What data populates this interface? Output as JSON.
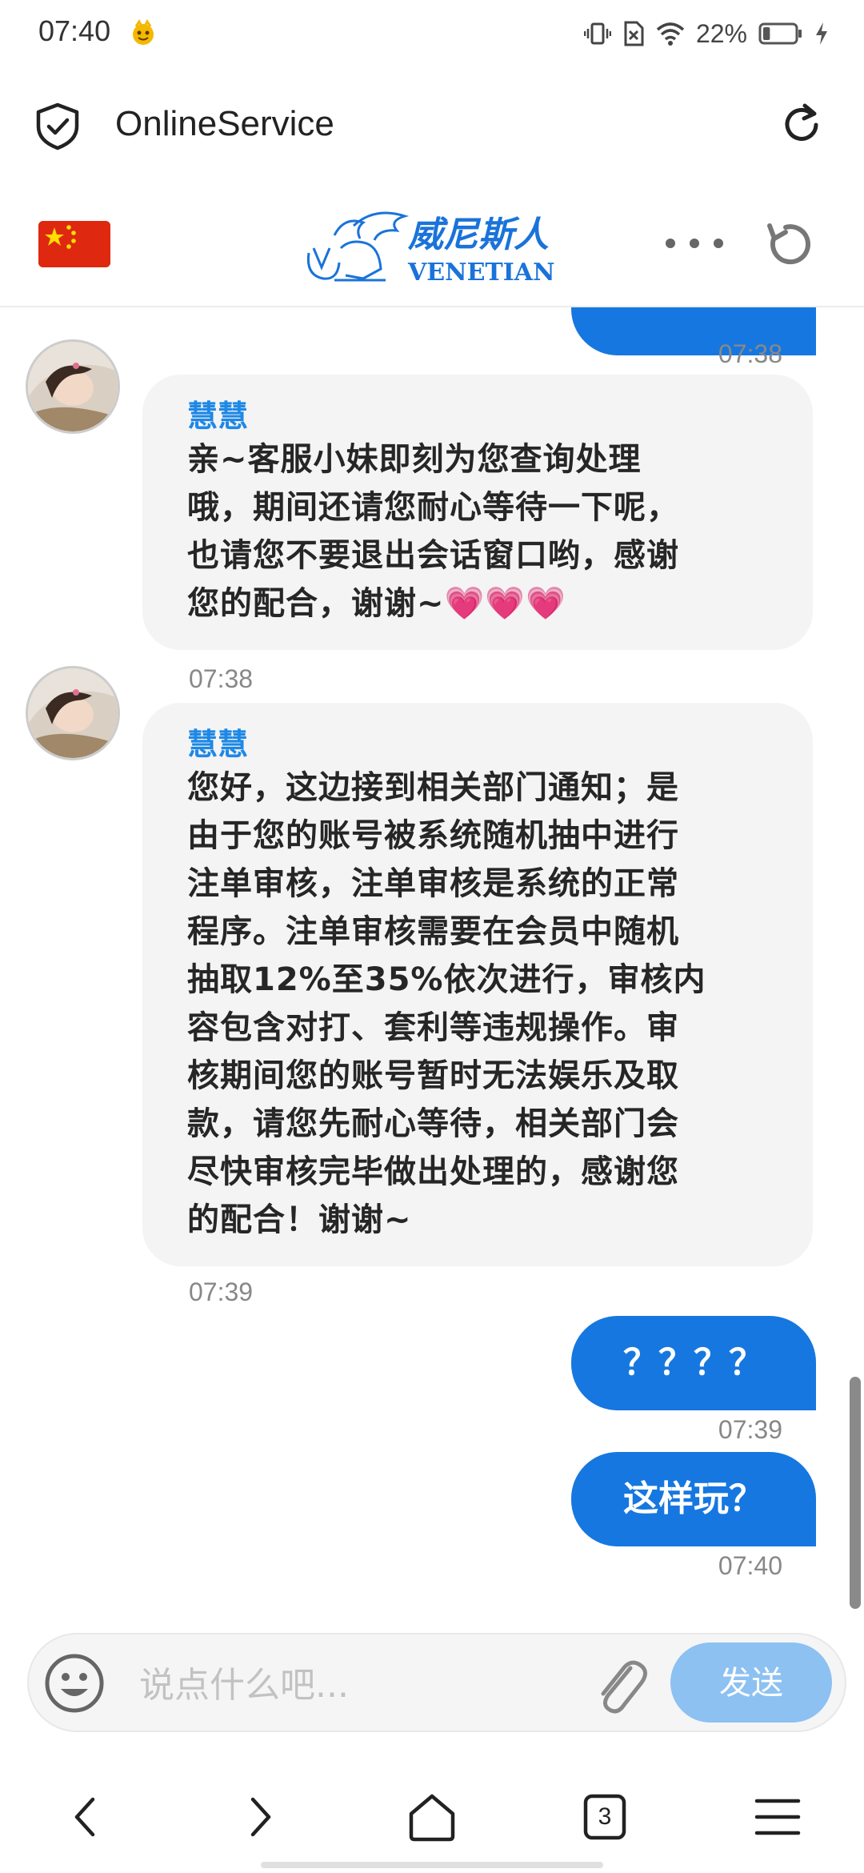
{
  "status_bar": {
    "time": "07:40",
    "battery_percent": "22%",
    "battery_level": 0.22,
    "icons": [
      "app-notification-icon",
      "vibrate-icon",
      "no-sim-icon",
      "wifi-icon",
      "battery-icon",
      "charging-icon"
    ]
  },
  "browser": {
    "title": "OnlineService",
    "icons": [
      "shield-check-icon",
      "reload-icon"
    ]
  },
  "site_header": {
    "brand_cn": "威尼斯人",
    "brand_en": "VENETIAN",
    "icons": [
      "china-flag-icon",
      "more-icon",
      "refresh-icon"
    ]
  },
  "messages": [
    {
      "type": "incoming",
      "sender": "慧慧",
      "lines": [
        "亲~客服小妹即刻为您查询处理",
        "哦，期间还请您耐心等待一下呢，",
        "也请您不要退出会话窗口哟，感谢",
        "您的配合，谢谢~💗💗💗"
      ],
      "time": "07:38"
    },
    {
      "type": "incoming",
      "sender": "慧慧",
      "lines": [
        "您好，这边接到相关部门通知；是",
        "由于您的账号被系统随机抽中进行",
        "注单审核，注单审核是系统的正常",
        "程序。注单审核需要在会员中随机",
        "抽取12%至35%依次进行，审核内",
        "容包含对打、套利等违规操作。审",
        "核期间您的账号暂时无法娱乐及取",
        "款，请您先耐心等待，相关部门会",
        "尽快审核完毕做出处理的，感谢您",
        "的配合！谢谢~"
      ],
      "time": "07:39"
    },
    {
      "type": "outgoing",
      "text": "？？？？",
      "time": "07:39"
    },
    {
      "type": "outgoing",
      "text": "这样玩？",
      "time": "07:40"
    }
  ],
  "previous_message_time": "07:38",
  "composer": {
    "placeholder": "说点什么吧...",
    "send_label": "发送",
    "icons": [
      "emoji-icon",
      "attachment-icon"
    ]
  },
  "nav": {
    "tab_count": "3",
    "icons": [
      "back-icon",
      "forward-icon",
      "home-icon",
      "tabs-icon",
      "menu-icon"
    ]
  },
  "colors": {
    "accent": "#1677e0",
    "sender": "#1e88e5",
    "incoming_bubble": "#f4f4f5",
    "send_button": "#8cc1f2"
  }
}
